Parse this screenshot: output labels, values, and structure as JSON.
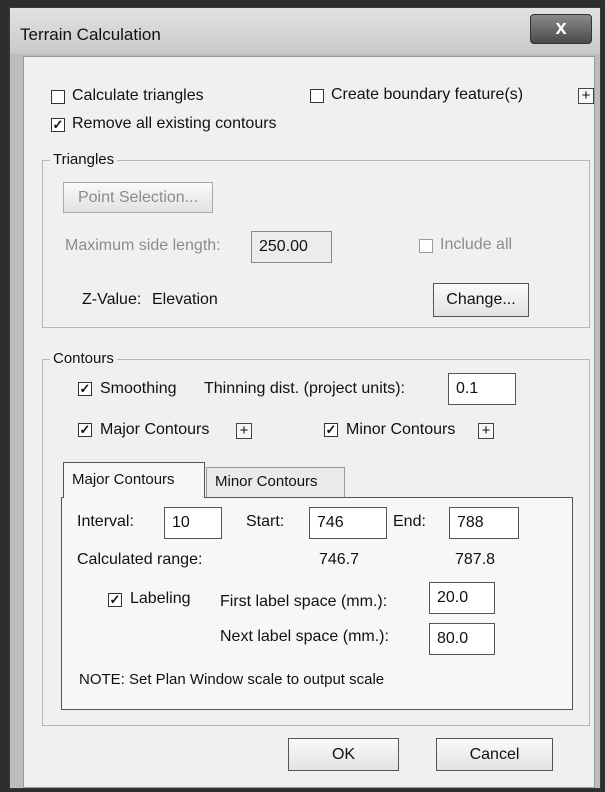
{
  "window": {
    "title": "Terrain Calculation",
    "close_glyph": "x"
  },
  "top": {
    "calc_triangles": {
      "label": "Calculate triangles",
      "checked": false
    },
    "create_boundary": {
      "label": "Create boundary feature(s)",
      "checked": false
    },
    "remove_contours": {
      "label": "Remove all existing contours",
      "checked": true
    },
    "plus_glyph": "+"
  },
  "triangles": {
    "title": "Triangles",
    "point_selection_label": "Point Selection...",
    "max_side_label": "Maximum side length:",
    "max_side_value": "250.00",
    "include_all": {
      "label": "Include all",
      "checked": false
    },
    "zvalue_label": "Z-Value:",
    "zvalue_text": "Elevation",
    "change_label": "Change..."
  },
  "contours": {
    "title": "Contours",
    "smoothing": {
      "label": "Smoothing",
      "checked": true
    },
    "thinning_label": "Thinning dist. (project units):",
    "thinning_value": "0.1",
    "major": {
      "label": "Major Contours",
      "checked": true
    },
    "minor": {
      "label": "Minor Contours",
      "checked": true
    },
    "plus_glyph": "+",
    "tabs": [
      {
        "label": "Major Contours",
        "active": true
      },
      {
        "label": "Minor Contours",
        "active": false
      }
    ],
    "panel": {
      "interval_label": "Interval:",
      "interval_value": "10",
      "start_label": "Start:",
      "start_value": "746",
      "end_label": "End:",
      "end_value": "788",
      "calc_range_label": "Calculated range:",
      "calc_start": "746.7",
      "calc_end": "787.8",
      "labeling": {
        "label": "Labeling",
        "checked": true
      },
      "first_space_label": "First label space (mm.):",
      "first_space_value": "20.0",
      "next_space_label": "Next label space (mm.):",
      "next_space_value": "80.0",
      "note": "NOTE: Set Plan Window scale to output scale"
    }
  },
  "buttons": {
    "ok": "OK",
    "cancel": "Cancel"
  },
  "check_glyph": "✓"
}
